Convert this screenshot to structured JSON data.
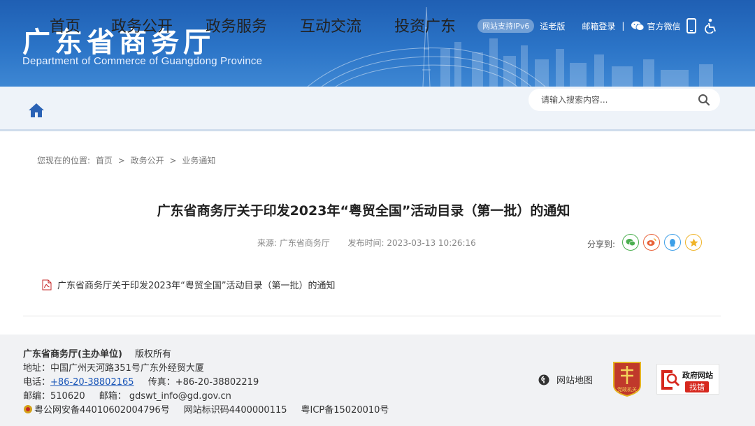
{
  "header": {
    "title_cn": "广东省商务厅",
    "title_en": "Department of Commerce of Guangdong Province",
    "ipv6": "网站支持IPv6",
    "elder_mode": "适老版",
    "email_login": "邮箱登录",
    "separator": "|",
    "wechat": "官方微信"
  },
  "nav": {
    "items": [
      "首页",
      "政务公开",
      "政务服务",
      "互动交流",
      "投资广东"
    ],
    "search_placeholder": "请输入搜索内容..."
  },
  "breadcrumb": {
    "prefix": "您现在的位置:",
    "items": [
      "首页",
      "政务公开",
      "业务通知"
    ],
    "sep": ">"
  },
  "article": {
    "title": "广东省商务厅关于印发2023年“粤贸全国”活动目录（第一批）的通知",
    "source": "来源:  广东省商务厅",
    "publish_time": "发布时间:  2023-03-13 10:26:16",
    "share_label": "分享到:",
    "attachment": "广东省商务厅关于印发2023年“粤贸全国”活动目录（第一批）的通知"
  },
  "footer": {
    "org": "广东省商务厅(主办单位)",
    "rights": "版权所有",
    "address": "地址：中国广州天河路351号广东外经贸大厦",
    "phone_label": "电话：",
    "phone": "+86-20-38802165",
    "fax": "传真：+86-20-38802219",
    "postcode": "邮编：510620",
    "email": "邮箱：  gdswt_info@gd.gov.cn",
    "police": "粤公网安备44010602004796号",
    "site_id": "网站标识码4400000115",
    "icp": "粤ICP备15020010号",
    "sitemap": "网站地图",
    "party_badge": "党政机关",
    "gov_badge_line1": "政府网站",
    "gov_badge_line2": "找错"
  },
  "colors": {
    "banner": "#2b74c7",
    "nav_bg": "#eef3f9",
    "footer_bg": "#f1f2f4",
    "link": "#1a56b8",
    "wechat_share": "#4caf50",
    "weibo_share": "#e8623a",
    "qq_share": "#3ea0e8",
    "qzone_share": "#f0b429"
  }
}
